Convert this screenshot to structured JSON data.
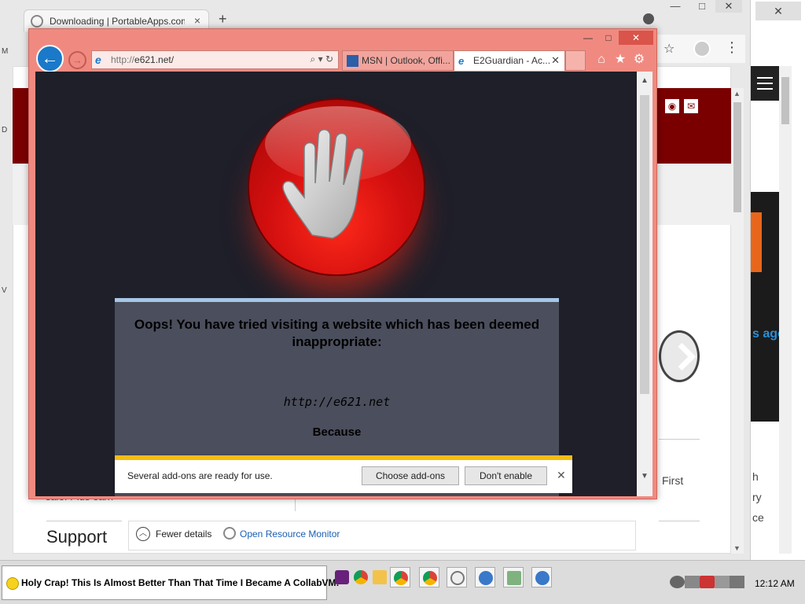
{
  "chrome": {
    "tab_title": "Downloading | PortableApps.com",
    "tab_close": "×",
    "new_tab": "+",
    "window_ctrls": [
      "—",
      "□",
      "✕"
    ]
  },
  "background_page": {
    "sale_text": "sale. Plus earn",
    "support": "Support",
    "first": "First"
  },
  "right_window": {
    "ago": "s ago",
    "close": "✕",
    "fragments": [
      "h",
      "ry",
      "ce"
    ]
  },
  "ie": {
    "window_ctrls": [
      "—",
      "□",
      "✕"
    ],
    "back": "←",
    "forward": "→",
    "address": {
      "prefix": "http://",
      "host": "e621.net/",
      "tools": "⌕ ▾ ↻"
    },
    "tabs": [
      {
        "label": "MSN | Outlook, Offi...",
        "active": false
      },
      {
        "label": "E2Guardian - Ac...",
        "active": true,
        "close": "✕"
      }
    ],
    "toolbar_icons": [
      "home-icon",
      "star-icon",
      "gear-icon"
    ],
    "toolbar_glyphs": [
      "⌂",
      "★",
      "⚙"
    ]
  },
  "block_page": {
    "title": "Oops! You have tried visiting a website which has been deemed inappropriate:",
    "url": "http://e621.net",
    "because": "Because"
  },
  "notification": {
    "text": "Several add-ons are ready for use.",
    "choose_label": "Choose add-ons",
    "disable_label": "Don't enable",
    "close": "✕"
  },
  "details_row": {
    "fewer_label": "Fewer details",
    "resource_monitor_label": "Open Resource Monitor"
  },
  "taskbar": {
    "chat_text": "Holy Crap! This Is Almost Better Than That Time I Became A CollabVM!",
    "clock": "12:12 AM",
    "apps": [
      "visual-studio",
      "chrome",
      "file-explorer",
      "chrome",
      "chrome",
      "portableapps",
      "ie",
      "task-manager",
      "ie"
    ]
  },
  "colors": {
    "ie_frame": "#f08a80",
    "ie_close": "#d9544a",
    "block_bg": "#1e1f29",
    "panel_bg": "#4b4e5c",
    "notify_bar": "#f4bd14",
    "bg_red_band": "#7a0000"
  }
}
